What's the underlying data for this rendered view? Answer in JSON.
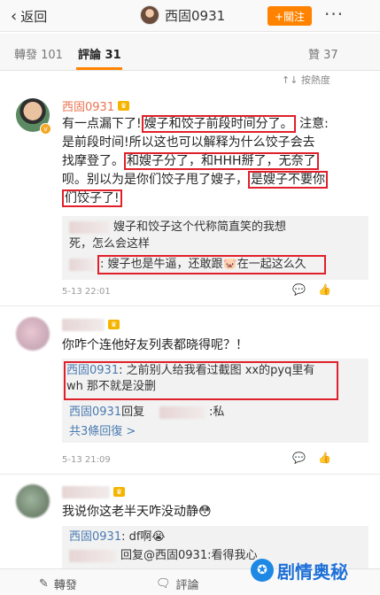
{
  "topbar": {
    "back_label": "返回",
    "title": "西固0931",
    "follow_label": "+關注",
    "more": "···"
  },
  "tabs": {
    "repost": "轉發 101",
    "comment": "評論 31",
    "like": "贊 37"
  },
  "sort_label": "↑↓ 按熱度",
  "comment1": {
    "user": "西固0931",
    "lines": [
      "有一点漏下了!",
      "嫂子和饺子前段时间分了。",
      "注意:",
      "是前段时间!所以这也可以解释为什么饺子会去",
      "找摩登了。",
      "和嫂子分了，和HHH掰了，无奈了",
      "呗。别以为是你们饺子甩了嫂子，",
      "是嫂子不要你",
      "们饺子了!"
    ],
    "reply1": "嫂子和饺子这个代称简直笑的我想",
    "reply1b": "死，怎么会这样",
    "reply2": ": 嫂子也是牛逼，还敢跟🐷在一起这么久",
    "time": "5-13 22:01"
  },
  "comment2": {
    "text": "你咋个连他好友列表都晓得呢？！",
    "reply_user": "西固0931",
    "reply_text": ": 之前别人给我看过截图 xx的pyq里有",
    "reply_text2": "wh 那不就是没删",
    "reply2_user": "西固0931",
    "reply2_text": "回复",
    "reply2_tail": ":私",
    "count": "共3條回復 >",
    "time": "5-13 21:09"
  },
  "comment3": {
    "text": "我说你这老半天咋没动静😳",
    "reply_user": "西固0931",
    "reply_text": ": df啊😭",
    "reply2": "回复@西固0931:看得我心",
    "count_placeholder": ""
  },
  "bottombar": {
    "repost": "轉發",
    "comment": "評論"
  },
  "watermark": {
    "text": "剧情奥秘"
  },
  "colors": {
    "accent": "#ff8200",
    "username": "#eb7350",
    "link": "#4a7ab0",
    "highlight_box": "#e0202a"
  }
}
